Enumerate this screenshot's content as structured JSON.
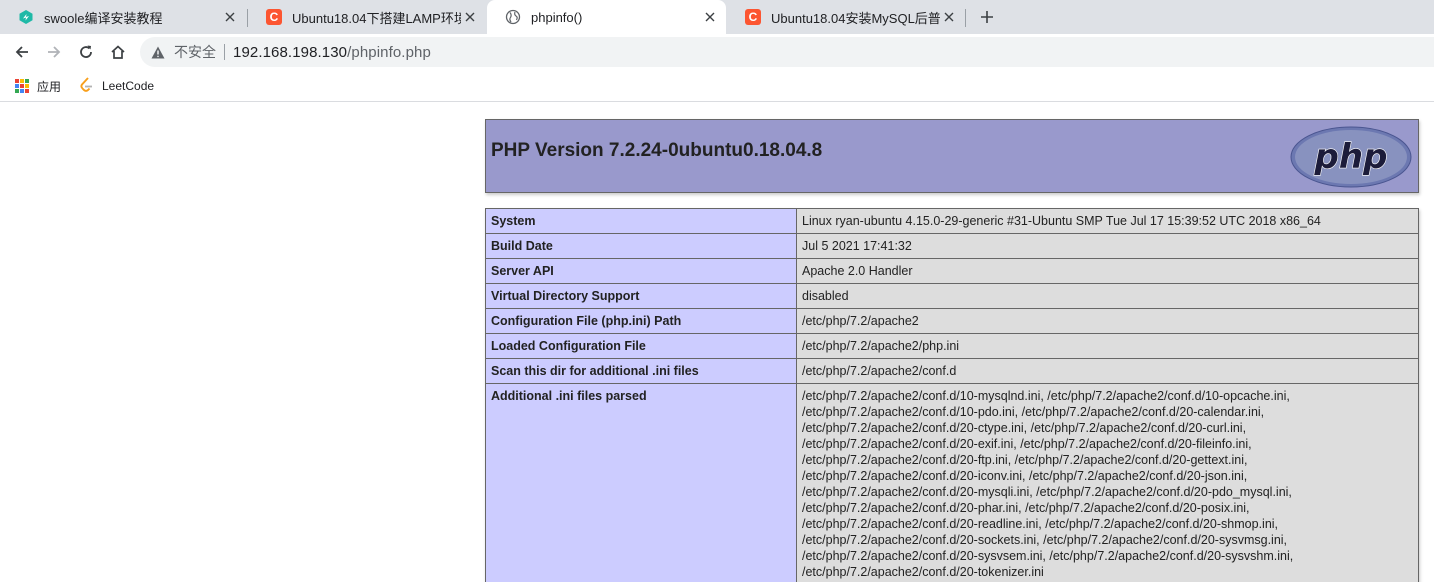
{
  "tabs": [
    {
      "title": "swoole编译安装教程",
      "favicon": "swoole-icon",
      "active": false
    },
    {
      "title": "Ubuntu18.04下搭建LAMP环境_",
      "favicon": "csdn-icon",
      "active": false
    },
    {
      "title": "phpinfo()",
      "favicon": "globe-icon",
      "active": true
    },
    {
      "title": "Ubuntu18.04安装MySQL后普通",
      "favicon": "csdn-icon",
      "active": false
    }
  ],
  "csdn_letter": "C",
  "toolbar": {
    "security_label": "不安全",
    "url_host": "192.168.198.130",
    "url_path": "/phpinfo.php"
  },
  "bookmarks": [
    {
      "label": "应用",
      "icon": "apps-grid-icon"
    },
    {
      "label": "LeetCode",
      "icon": "leetcode-icon"
    }
  ],
  "php": {
    "version_title": "PHP Version 7.2.24-0ubuntu0.18.04.8",
    "logo_text": "php",
    "rows": [
      {
        "key": "System",
        "value": [
          "Linux ryan-ubuntu 4.15.0-29-generic #31-Ubuntu SMP Tue Jul 17 15:39:52 UTC 2018 x86_64"
        ]
      },
      {
        "key": "Build Date",
        "value": [
          "Jul 5 2021 17:41:32"
        ]
      },
      {
        "key": "Server API",
        "value": [
          "Apache 2.0 Handler"
        ]
      },
      {
        "key": "Virtual Directory Support",
        "value": [
          "disabled"
        ]
      },
      {
        "key": "Configuration File (php.ini) Path",
        "value": [
          "/etc/php/7.2/apache2"
        ]
      },
      {
        "key": "Loaded Configuration File",
        "value": [
          "/etc/php/7.2/apache2/php.ini"
        ]
      },
      {
        "key": "Scan this dir for additional .ini files",
        "value": [
          "/etc/php/7.2/apache2/conf.d"
        ]
      },
      {
        "key": "Additional .ini files parsed",
        "value": [
          "/etc/php/7.2/apache2/conf.d/10-mysqlnd.ini, /etc/php/7.2/apache2/conf.d/10-opcache.ini,",
          "/etc/php/7.2/apache2/conf.d/10-pdo.ini, /etc/php/7.2/apache2/conf.d/20-calendar.ini,",
          "/etc/php/7.2/apache2/conf.d/20-ctype.ini, /etc/php/7.2/apache2/conf.d/20-curl.ini,",
          "/etc/php/7.2/apache2/conf.d/20-exif.ini, /etc/php/7.2/apache2/conf.d/20-fileinfo.ini,",
          "/etc/php/7.2/apache2/conf.d/20-ftp.ini, /etc/php/7.2/apache2/conf.d/20-gettext.ini,",
          "/etc/php/7.2/apache2/conf.d/20-iconv.ini, /etc/php/7.2/apache2/conf.d/20-json.ini,",
          "/etc/php/7.2/apache2/conf.d/20-mysqli.ini, /etc/php/7.2/apache2/conf.d/20-pdo_mysql.ini,",
          "/etc/php/7.2/apache2/conf.d/20-phar.ini, /etc/php/7.2/apache2/conf.d/20-posix.ini,",
          "/etc/php/7.2/apache2/conf.d/20-readline.ini, /etc/php/7.2/apache2/conf.d/20-shmop.ini,",
          "/etc/php/7.2/apache2/conf.d/20-sockets.ini, /etc/php/7.2/apache2/conf.d/20-sysvmsg.ini,",
          "/etc/php/7.2/apache2/conf.d/20-sysvsem.ini, /etc/php/7.2/apache2/conf.d/20-sysvshm.ini,",
          "/etc/php/7.2/apache2/conf.d/20-tokenizer.ini"
        ]
      }
    ]
  },
  "colors": {
    "tabstrip_bg": "#dee1e6",
    "header_bg": "#9999cc",
    "key_cell_bg": "#ccccff",
    "value_cell_bg": "#dddddd",
    "csdn_red": "#fc5531"
  }
}
